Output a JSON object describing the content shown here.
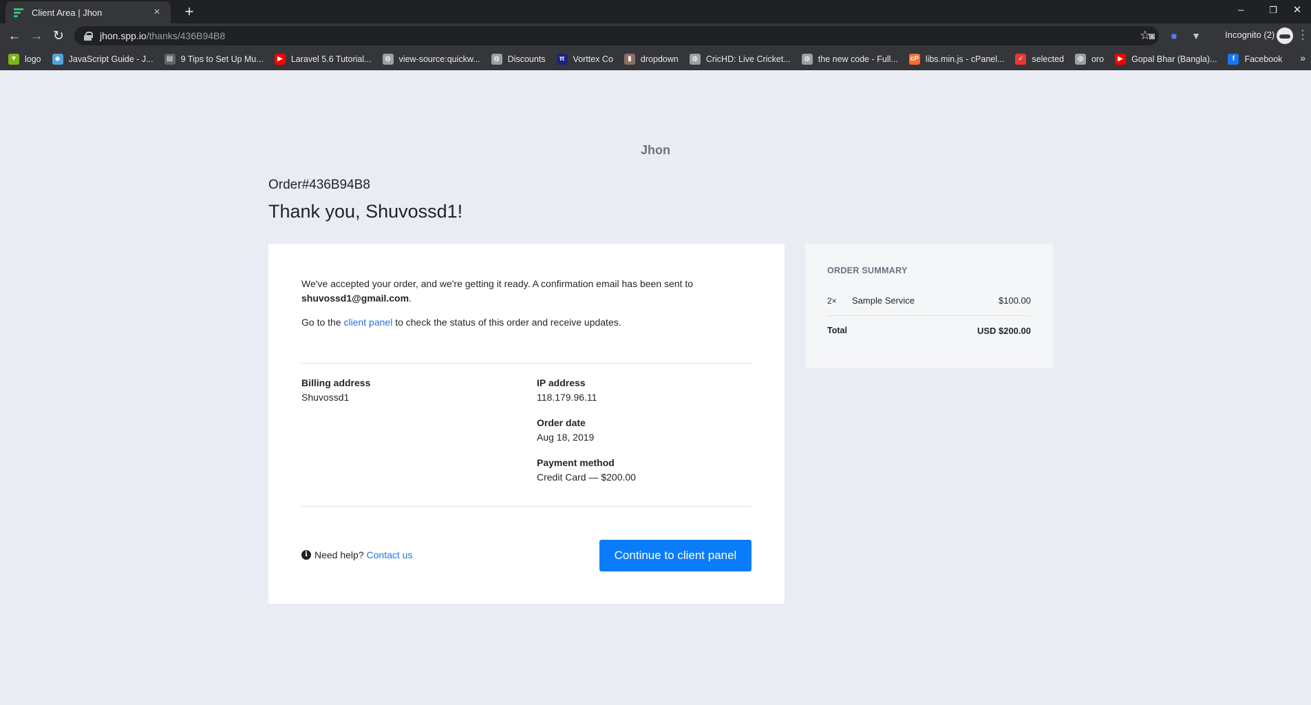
{
  "browser": {
    "tab_title": "Client Area | Jhon",
    "tab_close": "×",
    "new_tab": "+",
    "url_host": "jhon.spp.io",
    "url_path": "/thanks/436B94B8",
    "incognito_label": "Incognito (2)",
    "window_minimize": "–",
    "window_restore": "❐",
    "window_close": "✕",
    "bookmarks": [
      {
        "label": "logo",
        "icon": "green-leaf-icon",
        "color": "#7cb518"
      },
      {
        "label": "JavaScript Guide - J...",
        "icon": "js-guide-icon",
        "color": "#4fa3e0"
      },
      {
        "label": "9 Tips to Set Up Mu...",
        "icon": "book-icon",
        "color": "#5f6368"
      },
      {
        "label": "Laravel 5.6 Tutorial...",
        "icon": "youtube-icon",
        "color": "#ff0000"
      },
      {
        "label": "view-source:quickw...",
        "icon": "globe-icon",
        "color": "#9aa0a6"
      },
      {
        "label": "Discounts",
        "icon": "globe-icon",
        "color": "#9aa0a6"
      },
      {
        "label": "Vorttex Co",
        "icon": "vorttex-icon",
        "color": "#1a237e"
      },
      {
        "label": "dropdown",
        "icon": "dropdown-icon",
        "color": "#8d6e63"
      },
      {
        "label": "CricHD: Live Cricket...",
        "icon": "globe-icon",
        "color": "#9aa0a6"
      },
      {
        "label": "the new code - Full...",
        "icon": "globe-icon",
        "color": "#9aa0a6"
      },
      {
        "label": "libs.min.js - cPanel...",
        "icon": "cpanel-icon",
        "color": "#ff6c2c"
      },
      {
        "label": "selected",
        "icon": "selected-icon",
        "color": "#e53935"
      },
      {
        "label": "oro",
        "icon": "globe-icon",
        "color": "#9aa0a6"
      },
      {
        "label": "Gopal Bhar (Bangla)...",
        "icon": "youtube-icon",
        "color": "#ff0000"
      },
      {
        "label": "Facebook",
        "icon": "facebook-icon",
        "color": "#1877f2"
      }
    ],
    "bookmarks_more": "»"
  },
  "page": {
    "brand": "Jhon",
    "order_id": "Order#436B94B8",
    "thank_you": "Thank you, Shuvossd1!",
    "message_prefix": "We've accepted your order, and we're getting it ready. A confirmation email has been sent to",
    "email": "shuvossd1@gmail.com",
    "message_suffix": ".",
    "panel_prefix": "Go to the",
    "panel_link": "client panel",
    "panel_suffix": "to check the status of this order and receive updates.",
    "billing_label": "Billing address",
    "billing_value": "Shuvossd1",
    "ip_label": "IP address",
    "ip_value": "118.179.96.11",
    "order_date_label": "Order date",
    "order_date_value": "Aug 18, 2019",
    "payment_label": "Payment method",
    "payment_value": "Credit Card — $200.00",
    "help_text": "Need help?",
    "contact_link": "Contact us",
    "continue_button": "Continue to client panel"
  },
  "summary": {
    "title": "ORDER SUMMARY",
    "items": [
      {
        "qty": "2×",
        "name": "Sample Service",
        "price": "$100.00"
      }
    ],
    "total_label": "Total",
    "total_value": "USD $200.00"
  },
  "colors": {
    "accent": "#0b7cf8",
    "link": "#1d72e8",
    "page_bg": "#e9ecf3"
  }
}
